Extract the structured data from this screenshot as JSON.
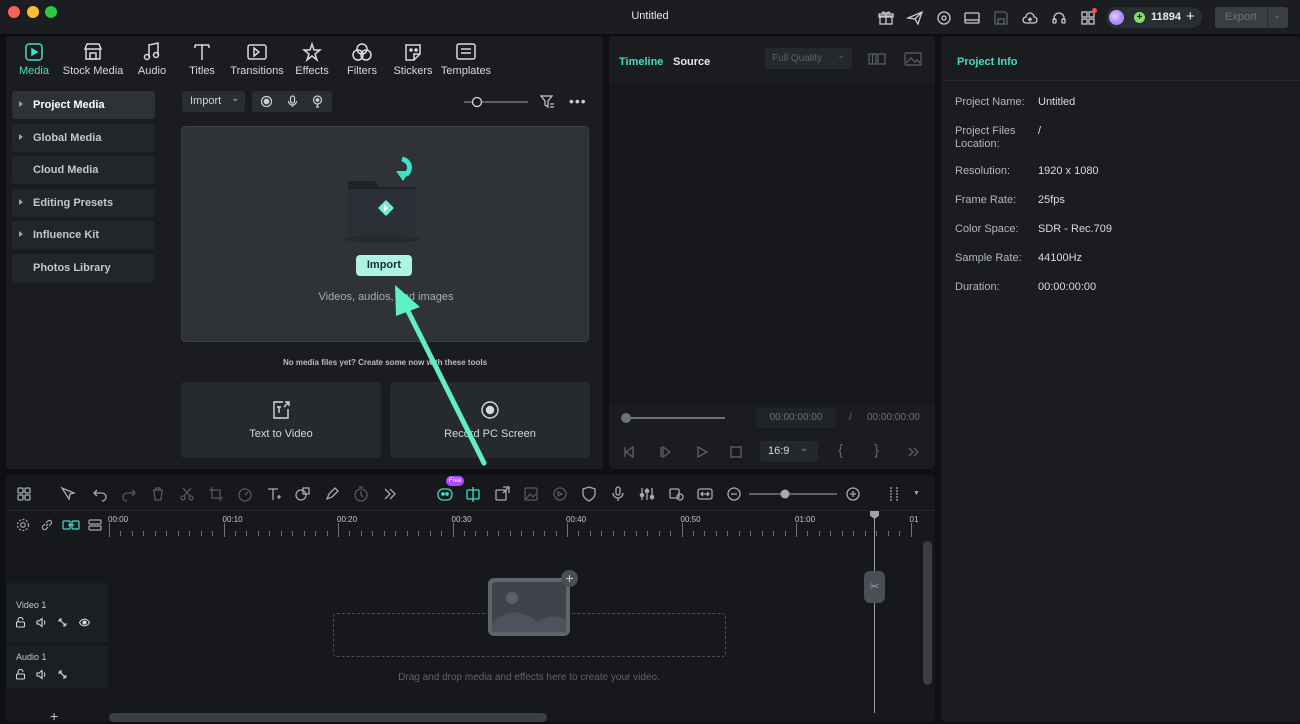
{
  "window": {
    "title": "Untitled"
  },
  "header": {
    "credits": "11894",
    "export_label": "Export"
  },
  "media_tabs": [
    {
      "label": "Media",
      "icon": "media-icon",
      "active": true
    },
    {
      "label": "Stock Media",
      "icon": "stock-media-icon",
      "active": false
    },
    {
      "label": "Audio",
      "icon": "music-note-icon",
      "active": false
    },
    {
      "label": "Titles",
      "icon": "titles-icon",
      "active": false
    },
    {
      "label": "Transitions",
      "icon": "transitions-icon",
      "active": false
    },
    {
      "label": "Effects",
      "icon": "effects-icon",
      "active": false
    },
    {
      "label": "Filters",
      "icon": "filters-icon",
      "active": false
    },
    {
      "label": "Stickers",
      "icon": "stickers-icon",
      "active": false
    },
    {
      "label": "Templates",
      "icon": "templates-icon",
      "active": false
    }
  ],
  "sidebar": {
    "items": [
      {
        "label": "Project Media",
        "expandable": true,
        "active": true
      },
      {
        "label": "Global Media",
        "expandable": true,
        "active": false
      },
      {
        "label": "Cloud Media",
        "expandable": false,
        "active": false
      },
      {
        "label": "Editing Presets",
        "expandable": true,
        "active": false
      },
      {
        "label": "Influence Kit",
        "expandable": true,
        "active": false
      },
      {
        "label": "Photos Library",
        "expandable": false,
        "active": false
      }
    ]
  },
  "media": {
    "import_dropdown": "Import",
    "import_button": "Import",
    "dropzone_caption": "Videos, audios, and images",
    "empty_hint": "No media files yet? Create some now with these tools",
    "tools": [
      {
        "label": "Text to Video",
        "icon": "text-to-video-icon"
      },
      {
        "label": "Record PC Screen",
        "icon": "record-screen-icon"
      }
    ]
  },
  "player": {
    "tab_timeline": "Timeline",
    "tab_source": "Source",
    "quality": "Full Quality",
    "current_time": "00:00:00:00",
    "separator": "/",
    "total_time": "00:00:00:00",
    "aspect_ratio": "16:9"
  },
  "project_info": {
    "title": "Project Info",
    "rows": [
      {
        "key": "Project Name:",
        "value": "Untitled"
      },
      {
        "key": "Project Files Location:",
        "value": "/"
      },
      {
        "key": "Resolution:",
        "value": "1920 x 1080"
      },
      {
        "key": "Frame Rate:",
        "value": "25fps"
      },
      {
        "key": "Color Space:",
        "value": "SDR - Rec.709"
      },
      {
        "key": "Sample Rate:",
        "value": "44100Hz"
      },
      {
        "key": "Duration:",
        "value": "00:00:00:00"
      }
    ]
  },
  "timeline": {
    "ai_badge": "Free",
    "ruler": [
      "00:00",
      "00:10",
      "00:20",
      "00:30",
      "00:40",
      "00:50",
      "01:00",
      "01"
    ],
    "tracks": [
      {
        "name": "Video 1"
      },
      {
        "name": "Audio 1"
      }
    ],
    "drop_hint": "Drag and drop media and effects here to create your video."
  },
  "colors": {
    "accent": "#3fe0c5",
    "import_button": "#aef2e4",
    "arrow": "#5ef0c0"
  }
}
